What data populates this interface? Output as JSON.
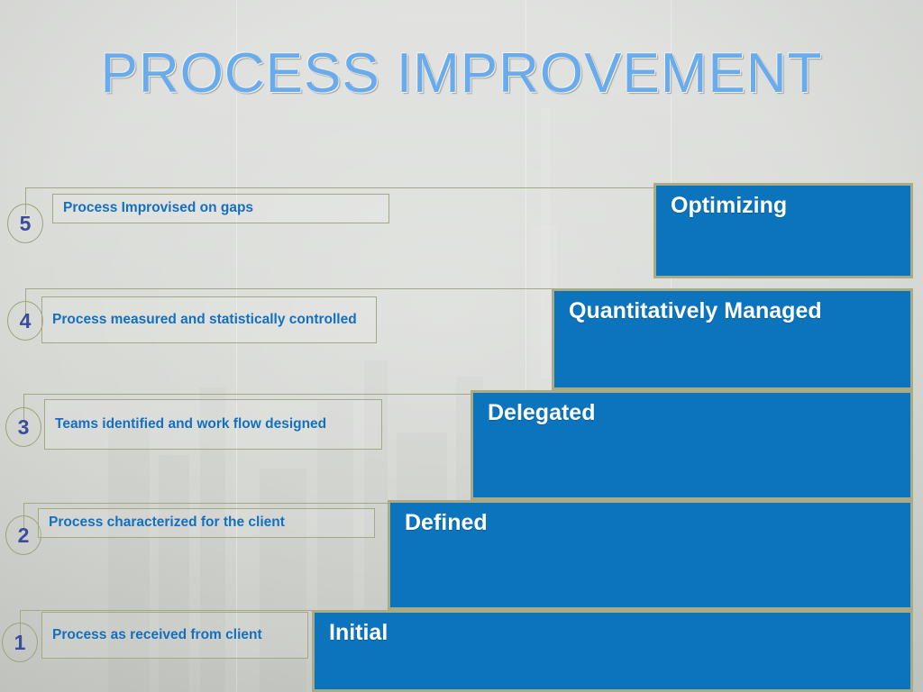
{
  "slide": {
    "title": "PROCESS IMPROVEMENT",
    "background_color": "#d8dad6",
    "accent_blue": "#0b74bd",
    "border_olive": "#a8ab86",
    "title_color": "#6aaceb",
    "callout_text_color": "#1470bf",
    "number_color": "#3c4b9c"
  },
  "maturity_levels": [
    {
      "number": "1",
      "stage": "Initial",
      "description": "Process as received from client"
    },
    {
      "number": "2",
      "stage": "Defined",
      "description": "Process characterized for the client"
    },
    {
      "number": "3",
      "stage": "Delegated",
      "description": "Teams identified and work flow designed"
    },
    {
      "number": "4",
      "stage": "Quantitatively Managed",
      "description": "Process measured and statistically controlled"
    },
    {
      "number": "5",
      "stage": "Optimizing",
      "description": "Process Improvised on gaps"
    }
  ]
}
